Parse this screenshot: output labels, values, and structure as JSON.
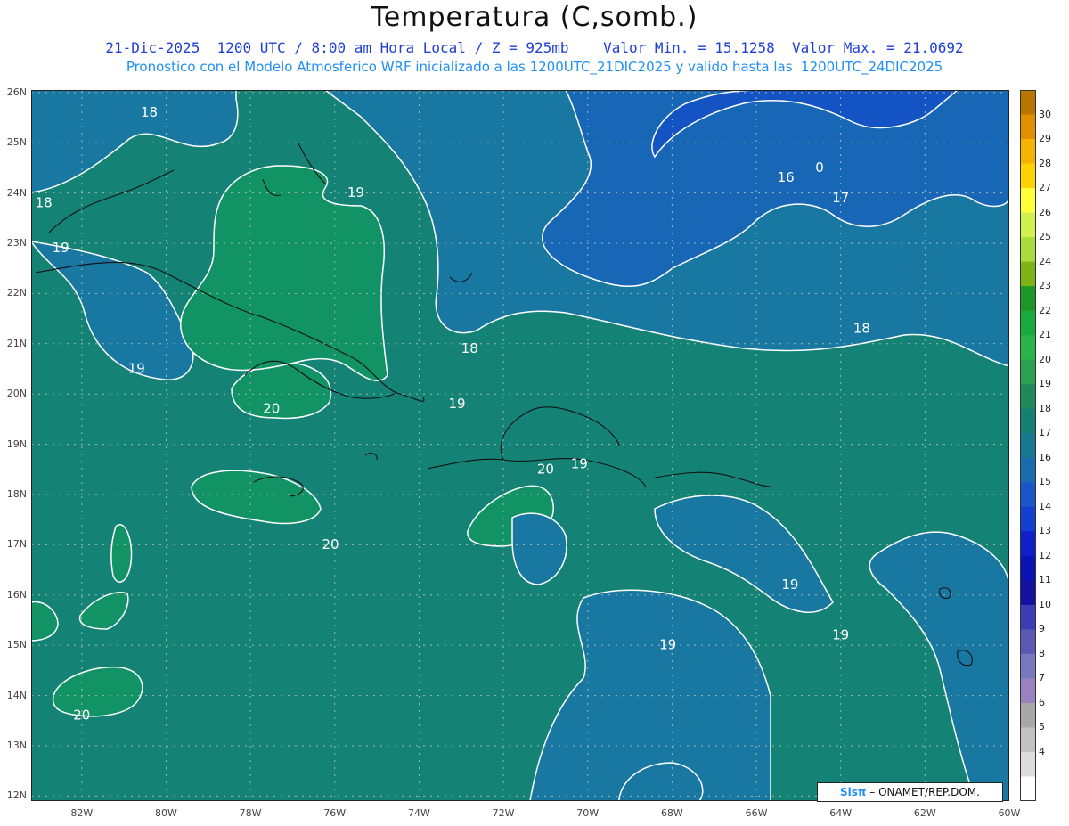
{
  "header": {
    "title": "Temperatura (C,somb.)",
    "line1": "21-Dic-2025  1200 UTC / 8:00 am Hora Local / Z = 925mb    Valor Min. = 15.1258  Valor Max. = 21.0692",
    "line2": "Pronostico con el Modelo Atmosferico WRF inicializado a las 1200UTC_21DIC2025 y valido hasta las  1200UTC_24DIC2025"
  },
  "axes": {
    "lat_labels": [
      "26N",
      "25N",
      "24N",
      "23N",
      "22N",
      "21N",
      "20N",
      "19N",
      "18N",
      "17N",
      "16N",
      "15N",
      "14N",
      "13N",
      "12N"
    ],
    "lon_labels": [
      "82W",
      "80W",
      "78W",
      "76W",
      "74W",
      "72W",
      "70W",
      "68W",
      "66W",
      "64W",
      "62W",
      "60W"
    ]
  },
  "contour_labels": [
    {
      "text": "18",
      "lon": -80.4,
      "lat": 25.6
    },
    {
      "text": "18",
      "lon": -82.9,
      "lat": 23.8
    },
    {
      "text": "19",
      "lon": -82.5,
      "lat": 22.9
    },
    {
      "text": "19",
      "lon": -75.5,
      "lat": 24.0
    },
    {
      "text": "16",
      "lon": -65.3,
      "lat": 24.3
    },
    {
      "text": "0",
      "lon": -64.5,
      "lat": 24.5
    },
    {
      "text": "17",
      "lon": -64.0,
      "lat": 23.9
    },
    {
      "text": "18",
      "lon": -72.8,
      "lat": 20.9
    },
    {
      "text": "18",
      "lon": -63.5,
      "lat": 21.3
    },
    {
      "text": "19",
      "lon": -80.7,
      "lat": 20.5
    },
    {
      "text": "20",
      "lon": -77.5,
      "lat": 19.7
    },
    {
      "text": "19",
      "lon": -73.1,
      "lat": 19.8
    },
    {
      "text": "20",
      "lon": -71.0,
      "lat": 18.5
    },
    {
      "text": "19",
      "lon": -70.2,
      "lat": 18.6
    },
    {
      "text": "20",
      "lon": -76.1,
      "lat": 17.0
    },
    {
      "text": "19",
      "lon": -65.2,
      "lat": 16.2
    },
    {
      "text": "19",
      "lon": -64.0,
      "lat": 15.2
    },
    {
      "text": "19",
      "lon": -68.1,
      "lat": 15.0
    },
    {
      "text": "20",
      "lon": -82.0,
      "lat": 13.6
    }
  ],
  "colorbar": {
    "labels": [
      "30",
      "29",
      "28",
      "27",
      "26",
      "25",
      "24",
      "23",
      "22",
      "21",
      "20",
      "19",
      "18",
      "17",
      "16",
      "15",
      "14",
      "13",
      "12",
      "11",
      "10",
      "9",
      "8",
      "7",
      "6",
      "5",
      "4"
    ],
    "colors": [
      "#b87800",
      "#e09000",
      "#f5b400",
      "#ffd200",
      "#ffff3c",
      "#d2f050",
      "#a8dc3c",
      "#7cb414",
      "#1e9628",
      "#1aaa3c",
      "#28b446",
      "#2aa050",
      "#1e8a5a",
      "#158070",
      "#187890",
      "#1a6cb0",
      "#1a56c8",
      "#1440d0",
      "#1020c8",
      "#0a14b4",
      "#1410a0",
      "#3c3cb4",
      "#5a5ab4",
      "#7878be",
      "#9a82c0",
      "#a8a8a8",
      "#c2c2c2",
      "#dcdcdc",
      "#ffffff"
    ]
  },
  "field_colors": {
    "c16": "#1453c4",
    "c17": "#1867b6",
    "c18": "#1878a2",
    "c19": "#148375",
    "c20": "#119365",
    "c21": "#1aa050"
  },
  "credit": {
    "brand": "Sisπ",
    "text": "– ONAMET/REP.DOM."
  }
}
